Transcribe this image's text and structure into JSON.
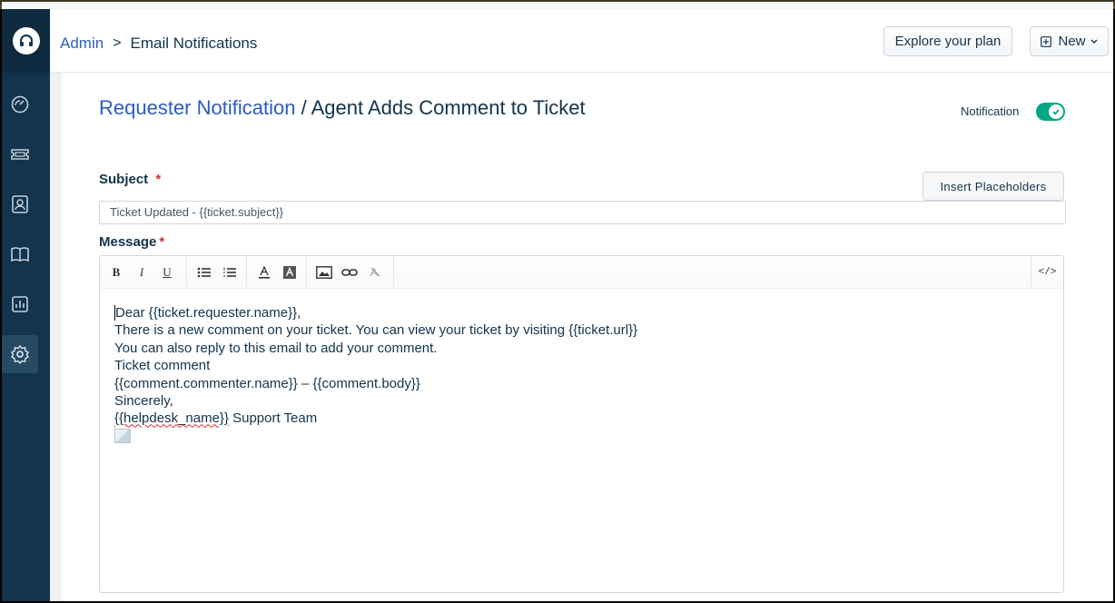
{
  "sidebar": {
    "logo": "headset-logo-icon",
    "items": [
      {
        "icon": "dashboard-icon"
      },
      {
        "icon": "tickets-icon"
      },
      {
        "icon": "contacts-icon"
      },
      {
        "icon": "solutions-icon"
      },
      {
        "icon": "analytics-icon"
      },
      {
        "icon": "admin-settings-icon",
        "active": true
      }
    ]
  },
  "header": {
    "breadcrumb_root": "Admin",
    "breadcrumb_separator": ">",
    "breadcrumb_current": "Email Notifications",
    "explore_button": "Explore your plan",
    "new_button": "New"
  },
  "page": {
    "title_link": "Requester Notification",
    "title_rest": " / Agent Adds Comment to Ticket",
    "notification_label": "Notification",
    "notification_enabled": true
  },
  "form": {
    "subject_label": "Subject",
    "required_mark": "*",
    "insert_placeholders": "Insert Placeholders",
    "subject_value": "Ticket Updated - {{ticket.subject}}",
    "message_label": "Message",
    "toolbar": {
      "bold": "B",
      "italic": "I",
      "underline": "U",
      "code_view": "</>"
    },
    "message_lines": [
      "Dear {{ticket.requester.name}},",
      "There is a new comment on your ticket. You can view your ticket by visiting {{ticket.url}}",
      "You can also reply to this email to add your comment.",
      "Ticket comment",
      "{{comment.commenter.name}} – {{comment.body}}",
      "Sincerely,"
    ],
    "signature_placeholder": "{{helpdesk_name}}",
    "signature_rest": " Support Team"
  },
  "colors": {
    "sidebar": "#12344d",
    "link": "#2c5cc5",
    "toggle_on": "#00a886",
    "required": "#d72d30"
  }
}
